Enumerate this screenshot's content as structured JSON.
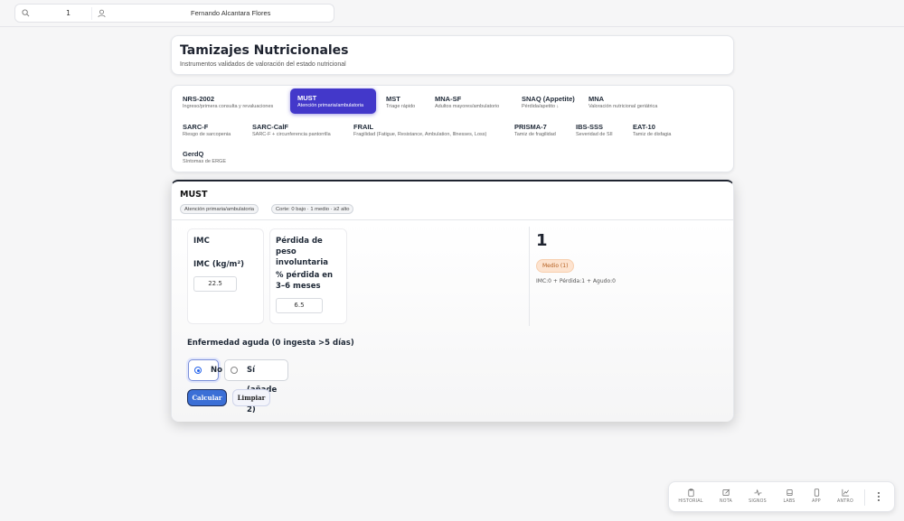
{
  "topbar": {
    "search_value": "1",
    "patient_name": "Fernando Alcantara Flores"
  },
  "header": {
    "title": "Tamizajes Nutricionales",
    "subtitle": "Instrumentos validados de valoración del estado nutricional"
  },
  "tools": [
    {
      "name": "NRS-2002",
      "desc": "Ingreso/primera consulta y revaluaciones",
      "active": false
    },
    {
      "name": "MUST",
      "desc": "Atención primaria/ambulatoria",
      "active": true
    },
    {
      "name": "MST",
      "desc": "Triage rápido",
      "active": false
    },
    {
      "name": "MNA-SF",
      "desc": "Adultos mayores/ambulatorio",
      "active": false
    },
    {
      "name": "SNAQ (Appetite)",
      "desc": "Pérdida/apetito ↓",
      "active": false
    },
    {
      "name": "MNA",
      "desc": "Valoración nutricional geriátrica",
      "active": false
    },
    {
      "name": "SARC-F",
      "desc": "Riesgo de sarcopenia",
      "active": false
    },
    {
      "name": "SARC-CalF",
      "desc": "SARC-F + circunferencia pantorrilla",
      "active": false
    },
    {
      "name": "FRAIL",
      "desc": "Fragilidad (Fatigue, Resistance, Ambulation, Illnesses, Loss)",
      "active": false
    },
    {
      "name": "PRISMA-7",
      "desc": "Tamiz de fragilidad",
      "active": false
    },
    {
      "name": "IBS-SSS",
      "desc": "Severidad de SII",
      "active": false
    },
    {
      "name": "EAT-10",
      "desc": "Tamiz de disfagia",
      "active": false
    },
    {
      "name": "GerdQ",
      "desc": "Síntomas de ERGE",
      "active": false
    }
  ],
  "calculator": {
    "title": "MUST",
    "tag_context": "Atención primaria/ambulatoria",
    "tag_cutoff": "Corte: 0 bajo · 1 medio · ≥2 alto",
    "imc_section": "IMC",
    "imc_label": "IMC (kg/m²)",
    "imc_value": "22.5",
    "weight_section": "Pérdida de peso involuntaria",
    "weight_label": "% pérdida en 3–6 meses",
    "weight_value": "6.5",
    "acute_label": "Enfermedad aguda (0 ingesta >5 días)",
    "option_no": "No",
    "option_yes": "Sí (añade 2)",
    "selected_option": "No",
    "calc_button": "Calcular",
    "clear_button": "Limpiar",
    "result_score": "1",
    "result_risk": "Medio (1)",
    "result_formula": "IMC:0 + Pérdida:1 + Agudo:0"
  },
  "bottom_nav": [
    {
      "label": "HISTORIAL",
      "icon": "clipboard-icon"
    },
    {
      "label": "NOTA",
      "icon": "edit-icon"
    },
    {
      "label": "SIGNOS",
      "icon": "pulse-icon"
    },
    {
      "label": "LABS",
      "icon": "flask-icon"
    },
    {
      "label": "APP",
      "icon": "phone-icon"
    },
    {
      "label": "ANTRO",
      "icon": "chart-icon"
    }
  ],
  "colors": {
    "accent": "#4338ca",
    "primary_button": "#3b6fd6",
    "risk_badge_bg": "#fde3cf",
    "risk_badge_text": "#b45e1f"
  }
}
